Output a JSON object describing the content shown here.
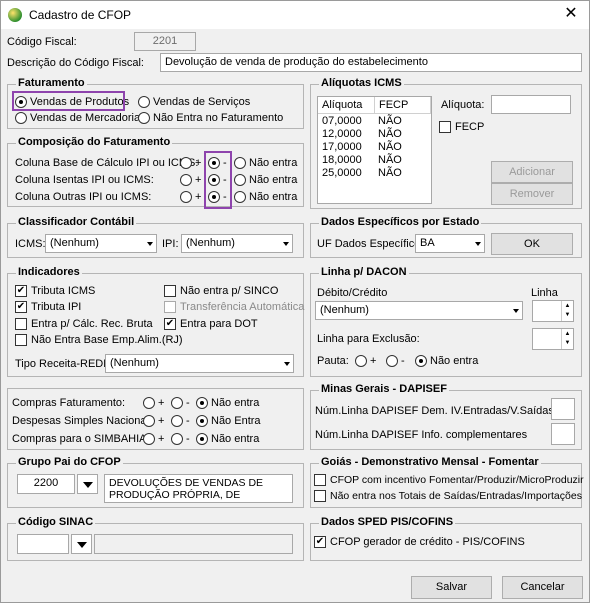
{
  "window": {
    "title": "Cadastro de CFOP",
    "close_glyph": "✕"
  },
  "header": {
    "codigo_label": "Código Fiscal:",
    "codigo_value": "2201",
    "descricao_label": "Descrição do Código Fiscal:",
    "descricao_value": "Devolução de venda de produção do estabelecimento"
  },
  "faturamento": {
    "title": "Faturamento",
    "options": [
      "Vendas de Produtos",
      "Vendas de Serviços",
      "Vendas de Mercadorias",
      "Não Entra no Faturamento"
    ],
    "selected": "Vendas de Produtos"
  },
  "composicao": {
    "title": "Composição do Faturamento",
    "rows": [
      {
        "label": "Coluna Base de Cálculo IPI ou ICMS:",
        "selected": "-"
      },
      {
        "label": "Coluna Isentas IPI ou ICMS:",
        "selected": "-"
      },
      {
        "label": "Coluna Outras IPI ou ICMS:",
        "selected": "-"
      }
    ],
    "opt_plus": "+",
    "opt_minus": "-",
    "opt_nao": "Não entra"
  },
  "aliquotas": {
    "title": "Alíquotas ICMS",
    "columns": [
      "Alíquota",
      "FECP"
    ],
    "rows": [
      [
        "07,0000",
        "NÃO"
      ],
      [
        "12,0000",
        "NÃO"
      ],
      [
        "17,0000",
        "NÃO"
      ],
      [
        "18,0000",
        "NÃO"
      ],
      [
        "25,0000",
        "NÃO"
      ]
    ],
    "aliquota_label": "Alíquota:",
    "fecp_label": "FECP",
    "adicionar": "Adicionar",
    "remover": "Remover"
  },
  "classificador": {
    "title": "Classificador Contábil",
    "icms_label": "ICMS:",
    "icms_value": "(Nenhum)",
    "ipi_label": "IPI:",
    "ipi_value": "(Nenhum)"
  },
  "dados_estado": {
    "title": "Dados Específicos por Estado",
    "uf_label": "UF Dados Específicos:",
    "uf_value": "BA",
    "ok": "OK"
  },
  "indicadores": {
    "title": "Indicadores",
    "checks": [
      {
        "label": "Tributa ICMS",
        "checked": true
      },
      {
        "label": "Não entra p/ SINCO",
        "checked": false
      },
      {
        "label": "Tributa IPI",
        "checked": true
      },
      {
        "label": "Transferência Automática",
        "checked": false,
        "disabled": true
      },
      {
        "label": "Entra p/ Cálc. Rec. Bruta",
        "checked": false
      },
      {
        "label": "Entra para DOT",
        "checked": true
      },
      {
        "label": "Não Entra Base Emp.Alim.(RJ)",
        "checked": false
      }
    ],
    "tipo_label": "Tipo Receita-REDF:",
    "tipo_value": "(Nenhum)"
  },
  "dacon": {
    "title": "Linha p/ DACON",
    "debito_label": "Débito/Crédito",
    "debito_value": "(Nenhum)",
    "linha_label": "Linha",
    "exclusao_label": "Linha para Exclusão:",
    "pauta_label": "Pauta:",
    "opt_plus": "+",
    "opt_minus": "-",
    "opt_nao": "Não entra"
  },
  "compras": {
    "rows": [
      {
        "label": "Compras Faturamento:",
        "selected": "Não entra"
      },
      {
        "label": "Despesas Simples Nacional:",
        "selected": "Não Entra"
      },
      {
        "label": "Compras para o SIMBAHIA:",
        "selected": "Não entra"
      }
    ],
    "opt_plus": "+",
    "opt_minus": "-"
  },
  "minas": {
    "title": "Minas Gerais - DAPISEF",
    "linha1": "Núm.Linha DAPISEF Dem. IV.Entradas/V.Saídas",
    "linha2": "Núm.Linha DAPISEF Info. complementares"
  },
  "grupo_pai": {
    "title": "Grupo Pai do CFOP",
    "code": "2200",
    "desc_line1": "DEVOLUÇÕES DE VENDAS DE",
    "desc_line2": "PRODUÇÃO PRÓPRIA, DE"
  },
  "goias": {
    "title": "Goiás - Demonstrativo Mensal - Fomentar",
    "check1": "CFOP com incentivo  Fomentar/Produzir/MicroProduzir",
    "check2": "Não entra nos Totais de  Saídas/Entradas/Importações"
  },
  "sinac": {
    "title": "Código SINAC"
  },
  "sped": {
    "title": "Dados SPED PIS/COFINS",
    "check": "CFOP gerador de crédito - PIS/COFINS",
    "checked": true
  },
  "footer": {
    "salvar": "Salvar",
    "cancelar": "Cancelar"
  },
  "colors": {
    "highlight": "#8e44ad",
    "window_bg": "#f0f0f0"
  }
}
